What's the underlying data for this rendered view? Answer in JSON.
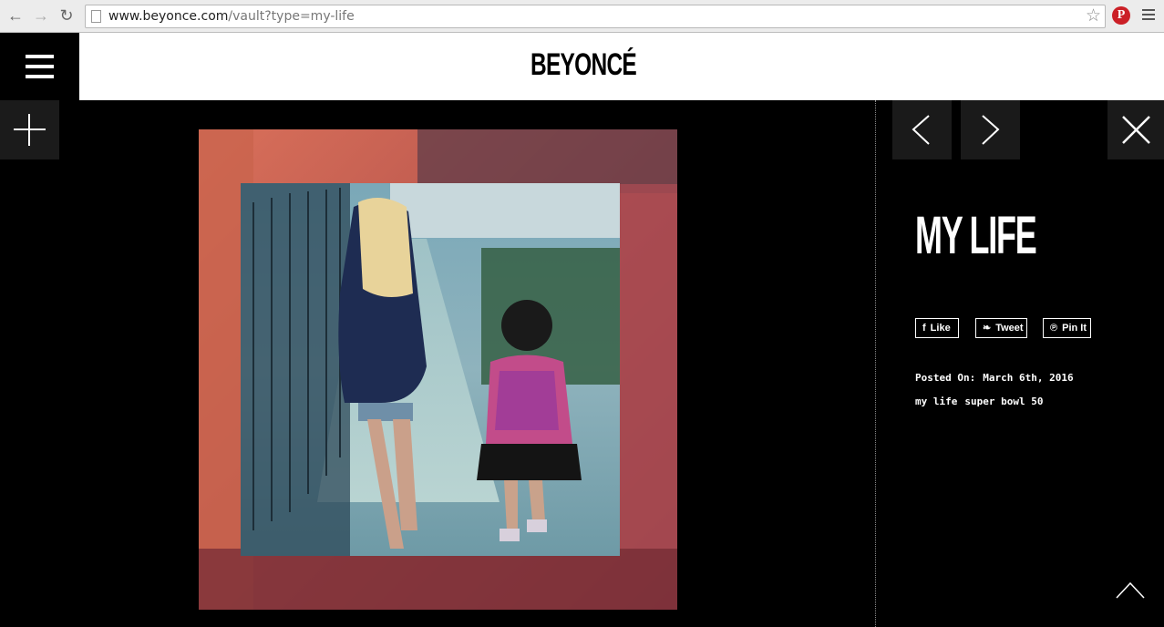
{
  "browser": {
    "url_domain": "www.beyonce.com",
    "url_path": "/vault?type=my-life"
  },
  "site": {
    "logo": "BEYONCÉ"
  },
  "post": {
    "title": "MY LIFE",
    "share": {
      "like": "Like",
      "tweet": "Tweet",
      "pin": "Pin It"
    },
    "posted_label": "Posted On:",
    "posted_date": "March 6th, 2016",
    "tags": [
      "my life",
      "super bowl 50"
    ]
  },
  "colors": {
    "background": "#000000",
    "header_bg": "#ffffff",
    "button_bg": "#1a1a1a",
    "pinterest": "#cb2027"
  },
  "icons": {
    "menu": "hamburger-icon",
    "add": "plus-icon",
    "prev": "chevron-left-icon",
    "next": "chevron-right-icon",
    "close": "close-icon",
    "scroll_top": "chevron-up-icon",
    "like": "facebook-icon",
    "tweet": "twitter-icon",
    "pin": "pinterest-icon"
  }
}
